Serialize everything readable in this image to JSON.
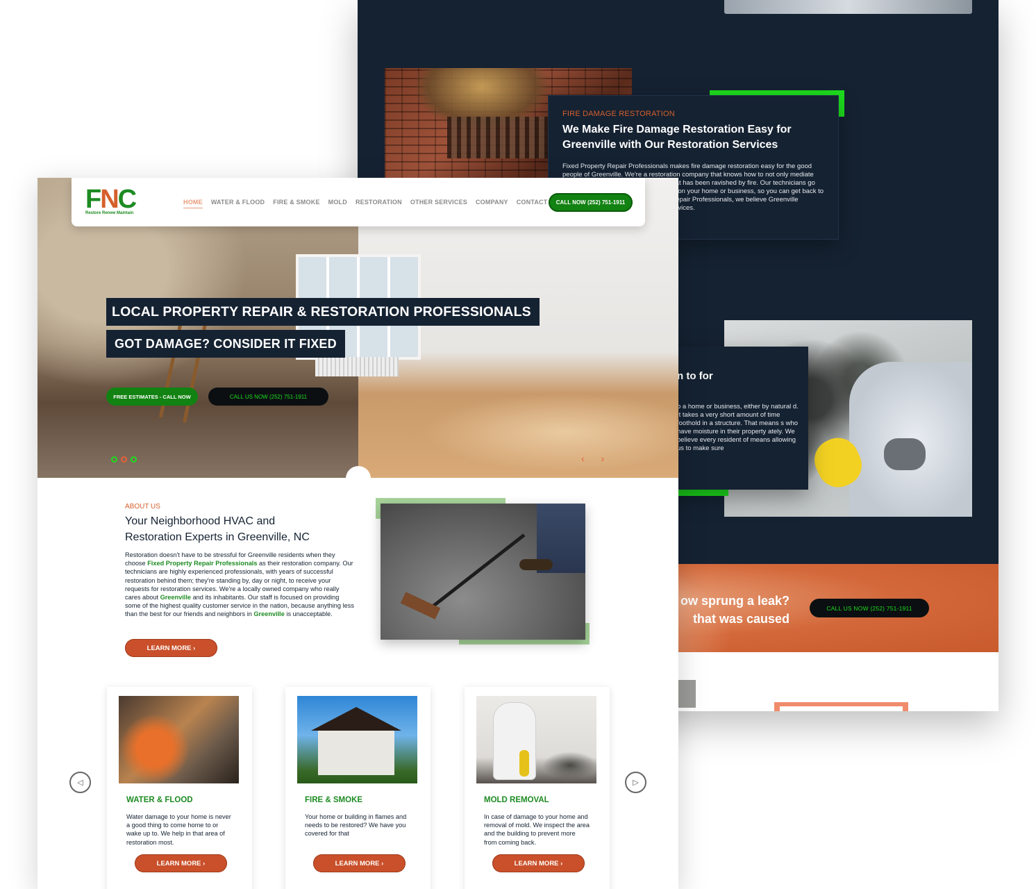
{
  "back": {
    "fire": {
      "kicker": "FIRE DAMAGE RESTORATION",
      "title_line1": "We Make Fire Damage Restoration Easy for",
      "title_line2": "Greenville with Our Restoration Services",
      "body": "Fixed Property Repair Professionals makes fire damage restoration easy for the good people of Greenville. We're a restoration company that knows how to not only mediate the damage but to restore a building that has been ravished by fire. Our technicians go through a thorough restoration process on your home or business, so you can get back to business as usual. At Fixed Property Repair Professionals, we believe Greenville deserves to have prompt and timely services."
    },
    "mold": {
      "title": "n to for",
      "body": "o a home or business, either by natural d. It takes a very short amount of time foothold in a structure. That means s who have moisture in their property ately. We believe every resident of means allowing us to make sure"
    },
    "cta": {
      "line1": "ow sprung a leak?",
      "line2": "that was caused",
      "button": "CALL US NOW (252) 751-1911"
    }
  },
  "nav": {
    "logo_letters": [
      "F",
      "N",
      "C"
    ],
    "logo_tagline": "Restore  Renew  Maintain",
    "items": [
      "HOME",
      "WATER & FLOOD",
      "FIRE & SMOKE",
      "MOLD",
      "RESTORATION",
      "OTHER SERVICES",
      "COMPANY",
      "CONTACT"
    ],
    "cta": "CALL NOW (252) 751-1911"
  },
  "hero": {
    "headline1": "LOCAL PROPERTY REPAIR & RESTORATION PROFESSIONALS",
    "headline2": "GOT DAMAGE? CONSIDER IT FIXED",
    "btn_estimates": "FREE ESTIMATES - CALL NOW",
    "btn_call": "CALL US NOW (252) 751-1911",
    "arrows": "‹ ›",
    "scroll_icon": "⌄"
  },
  "about": {
    "kicker": "ABOUT US",
    "title": "Your Neighborhood HVAC and Restoration Experts in Greenville, NC",
    "p_a": "Restoration doesn't have to be stressful for Greenville residents when they choose ",
    "p_link1": "Fixed Property Repair Professionals",
    "p_b": " as their restoration company. Our technicians are highly experienced professionals, with years of successful restoration behind them; they're standing by, day or night, to receive your requests for restoration services. We're a locally owned company who really cares about ",
    "p_link2": "Greenville",
    "p_c": " and its inhabitants. Our staff is focused on providing some of the highest quality customer service in the nation, because anything less than the best for our friends and neighbors in ",
    "p_link3": "Greenville",
    "p_d": " is unacceptable.",
    "button": "LEARN MORE   ›"
  },
  "services": [
    {
      "title": "WATER & FLOOD",
      "body": "Water damage to your home is never a good thing to come home to or wake up to. We help in that area of restoration most.",
      "button": "LEARN MORE   ›"
    },
    {
      "title": "FIRE & SMOKE",
      "body": "Your home or building in flames and needs to be restored? We have you covered for that",
      "button": "LEARN MORE   ›"
    },
    {
      "title": "MOLD REMOVAL",
      "body": "In case of damage to your home and removal of mold. We inspect the area and the building to prevent more from coming back.",
      "button": "LEARN MORE   ›"
    }
  ],
  "carousel": {
    "prev": "◁",
    "next": "▷"
  },
  "colors": {
    "navy": "#152232",
    "green": "#128212",
    "bright_green": "#1ddc1d",
    "orange": "#c9502a"
  }
}
